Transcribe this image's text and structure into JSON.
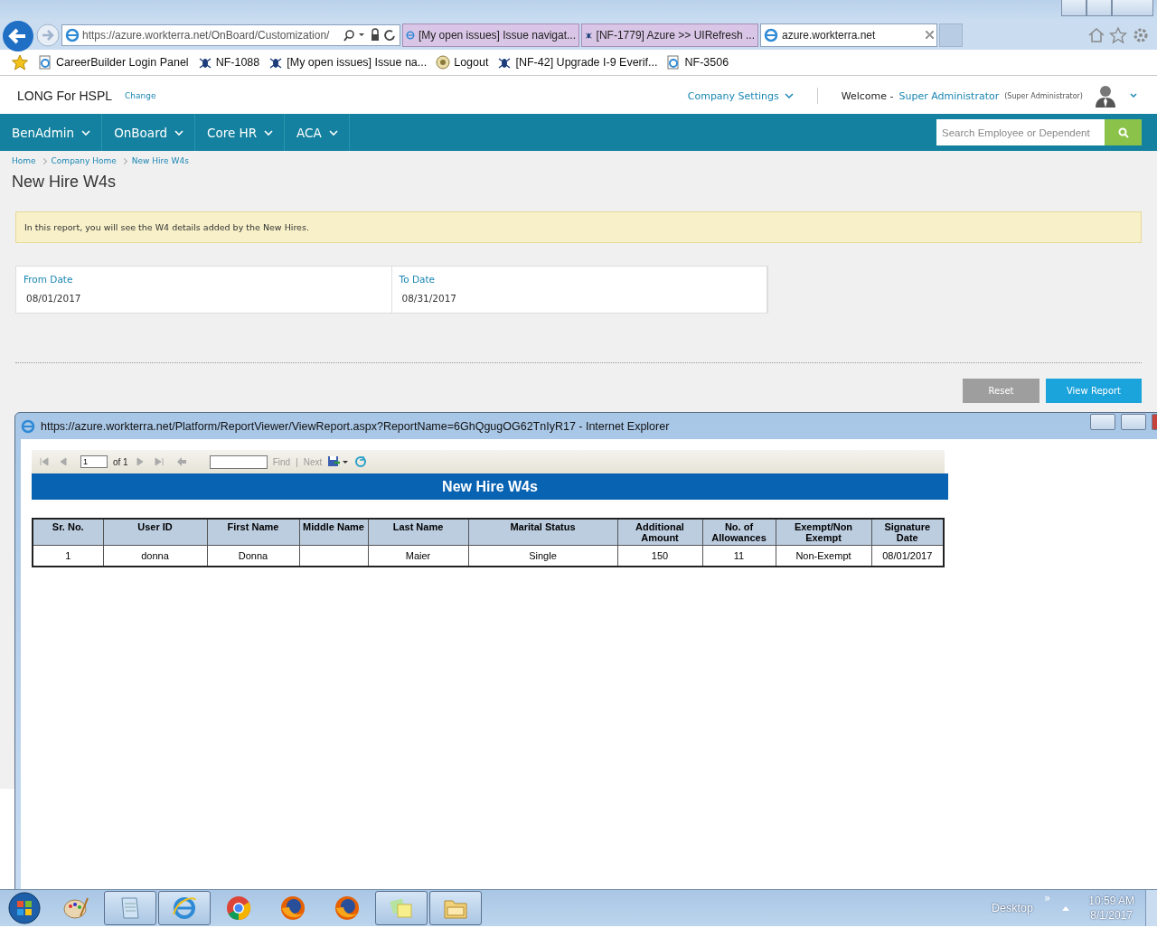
{
  "browser": {
    "address": "https://azure.workterra.net/OnBoard/Customization/",
    "tabs": [
      {
        "label": "[My open issues] Issue navigat...",
        "kind": "ie",
        "selected": false
      },
      {
        "label": "[NF-1779] Azure >> UIRefresh ...",
        "kind": "bug",
        "selected": false
      },
      {
        "label": "azure.workterra.net",
        "kind": "ie",
        "selected": true
      }
    ],
    "favorites": [
      {
        "label": "CareerBuilder Login Panel",
        "kind": "page"
      },
      {
        "label": "NF-1088",
        "kind": "bug"
      },
      {
        "label": "[My open issues] Issue na...",
        "kind": "bug"
      },
      {
        "label": "Logout",
        "kind": "logout"
      },
      {
        "label": "[NF-42] Upgrade I-9 Everif...",
        "kind": "bug"
      },
      {
        "label": "NF-3506",
        "kind": "page"
      }
    ]
  },
  "header": {
    "company": "LONG For HSPL",
    "change_link": "Change",
    "company_settings": "Company Settings",
    "welcome": "Welcome -",
    "user": "Super Administrator",
    "role": "(Super Administrator)"
  },
  "nav": {
    "items": [
      {
        "label": "BenAdmin"
      },
      {
        "label": "OnBoard"
      },
      {
        "label": "Core HR"
      },
      {
        "label": "ACA"
      }
    ],
    "search": {
      "placeholder": "Search Employee or Dependent"
    }
  },
  "breadcrumb": [
    "Home",
    "Company Home",
    "New Hire W4s"
  ],
  "page_title": "New Hire W4s",
  "info": "In this report, you will see the W4 details added by the New Hires.",
  "filters": [
    {
      "label": "From Date",
      "value": "08/01/2017"
    },
    {
      "label": "To Date",
      "value": "08/31/2017"
    }
  ],
  "buttons": [
    {
      "label": "Reset",
      "kind": "secondary"
    },
    {
      "label": "View Report",
      "kind": "primary"
    }
  ],
  "popup": {
    "title": "https://azure.workterra.net/Platform/ReportViewer/ViewReport.aspx?ReportName=6GhQgugOG62TnIyR17 - Internet Explorer",
    "toolbar": {
      "page": "1",
      "of": "of 1",
      "find": "Find",
      "separator": "|",
      "next": "Next"
    },
    "report_title": "New Hire W4s",
    "table": {
      "columns": [
        "Sr. No.",
        "User ID",
        "First Name",
        "Middle Name",
        "Last Name",
        "Marital Status",
        "Additional Amount",
        "No. of Allowances",
        "Exempt/Non Exempt",
        "Signature Date"
      ],
      "rows": [
        [
          "1",
          "donna",
          "Donna",
          "",
          "Maier",
          "Single",
          "150",
          "11",
          "Non-Exempt",
          "08/01/2017"
        ]
      ]
    }
  },
  "taskbar": {
    "apps": [
      {
        "kind": "paint",
        "open": false
      },
      {
        "kind": "notepad",
        "open": true
      },
      {
        "kind": "ie",
        "open": true
      },
      {
        "kind": "chrome",
        "open": false
      },
      {
        "kind": "firefox",
        "open": false
      },
      {
        "kind": "firefox",
        "open": false
      },
      {
        "kind": "sticky",
        "open": true
      },
      {
        "kind": "folder",
        "open": true
      }
    ],
    "desktop": "Desktop",
    "chevron": "»",
    "time": "10:59 AM",
    "date": "8/1/2017"
  }
}
